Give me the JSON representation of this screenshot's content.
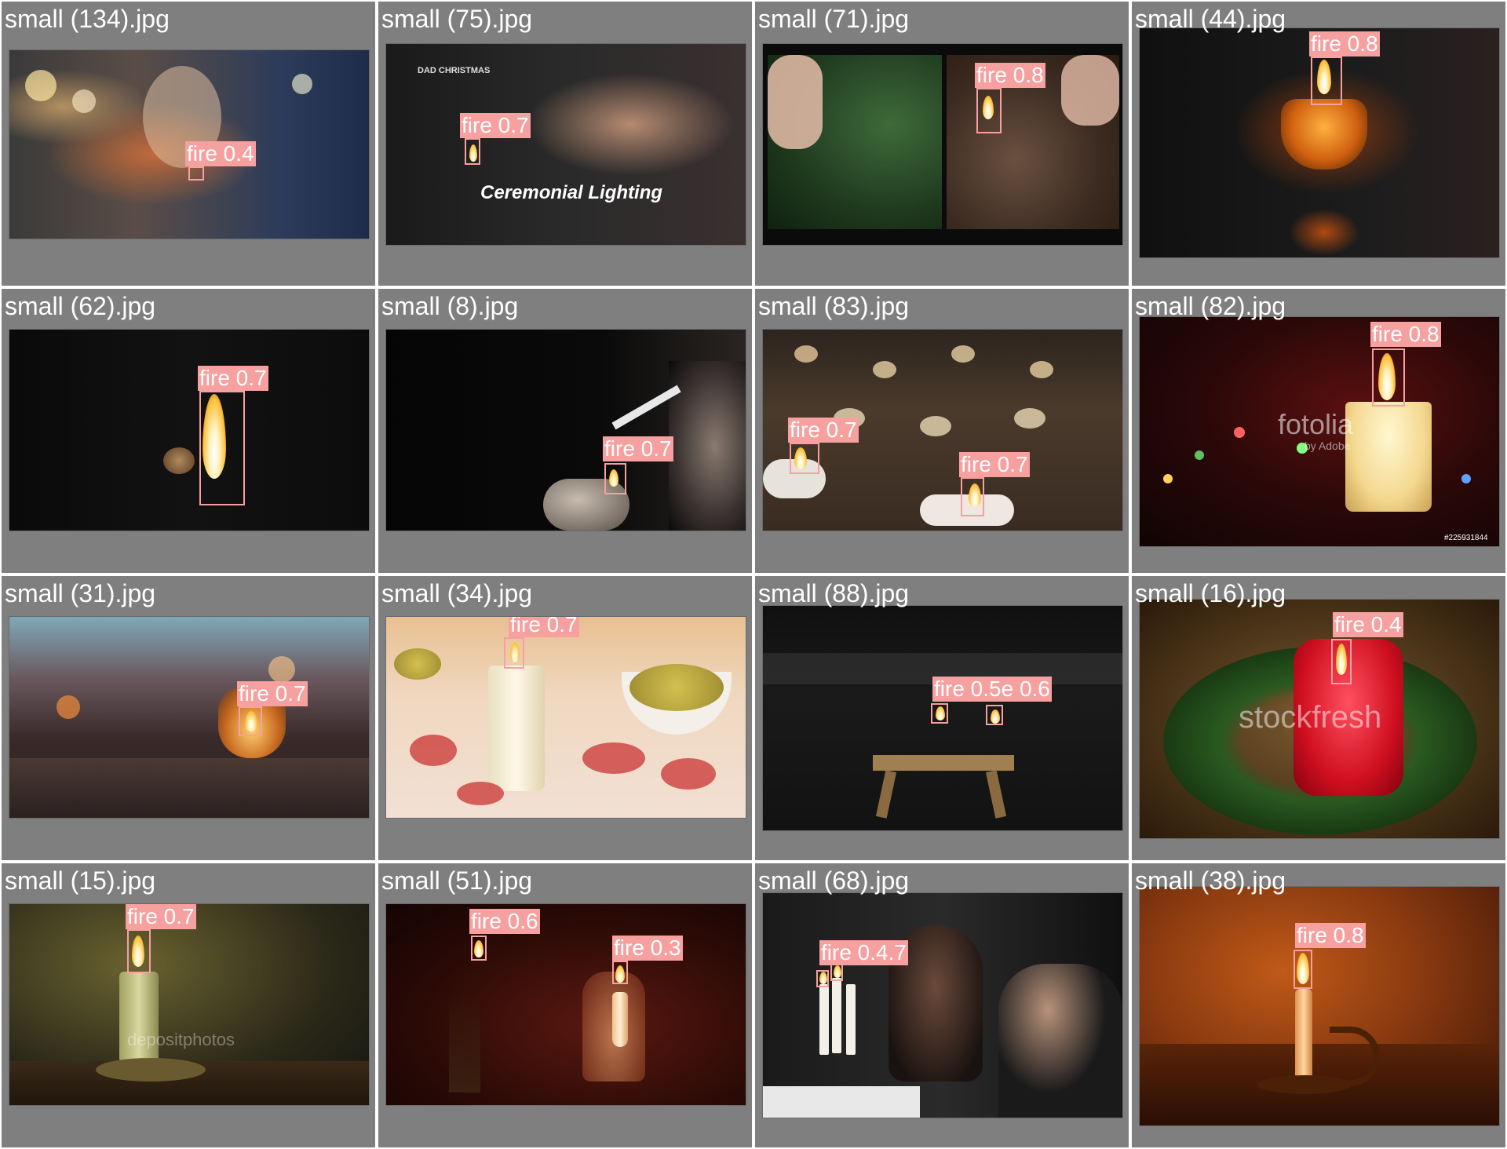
{
  "grid": {
    "cells": [
      {
        "filename": "small (134).jpg",
        "labels": [
          "fire 0.4"
        ],
        "scene": "man-lighting-cigarette"
      },
      {
        "filename": "small (75).jpg",
        "labels": [
          "fire 0.7"
        ],
        "scene": "ceremonial-lighting",
        "overlay": {
          "title": "Ceremonial Lighting",
          "logo": "DAD CHRISTMAS"
        }
      },
      {
        "filename": "small (71).jpg",
        "labels": [
          "fire 0.8"
        ],
        "scene": "two-smokers"
      },
      {
        "filename": "small (44).jpg",
        "labels": [
          "fire 0.8"
        ],
        "scene": "candle-glass-dark"
      },
      {
        "filename": "small (62).jpg",
        "labels": [
          "fire 0.7"
        ],
        "scene": "lighter-flame-dark"
      },
      {
        "filename": "small (8).jpg",
        "labels": [
          "fire 0.7"
        ],
        "scene": "cigarette-lighter-dark"
      },
      {
        "filename": "small (83).jpg",
        "labels": [
          "fire 0.7",
          "fire 0.7"
        ],
        "scene": "tealights-rows"
      },
      {
        "filename": "small (82).jpg",
        "labels": [
          "fire 0.8"
        ],
        "scene": "candle-bokeh-lights",
        "overlay": {
          "watermark": "fotolia",
          "sub": "by Adobe",
          "id": "#225931844"
        }
      },
      {
        "filename": "small (31).jpg",
        "labels": [
          "fire 0.7"
        ],
        "scene": "tealight-glass-bar"
      },
      {
        "filename": "small (34).jpg",
        "labels": [
          "fire 0.7"
        ],
        "scene": "candle-petals"
      },
      {
        "filename": "small (88).jpg",
        "labels": [
          "fire 0.5e 0.6"
        ],
        "scene": "lanterns-table-night"
      },
      {
        "filename": "small (16).jpg",
        "labels": [
          "fire 0.4"
        ],
        "scene": "red-candle-wreath",
        "overlay": {
          "watermark": "stockfresh"
        }
      },
      {
        "filename": "small (15).jpg",
        "labels": [
          "fire 0.7"
        ],
        "scene": "candlestick-holder",
        "overlay": {
          "watermark": "depositphotos"
        }
      },
      {
        "filename": "small (51).jpg",
        "labels": [
          "fire 0.6",
          "fire 0.3"
        ],
        "scene": "candles-dark-red"
      },
      {
        "filename": "small (68).jpg",
        "labels": [
          "fire 0.4.7"
        ],
        "scene": "dinner-candelabra"
      },
      {
        "filename": "small (38).jpg",
        "labels": [
          "fire 0.8"
        ],
        "scene": "single-candle-orange"
      }
    ]
  },
  "colors": {
    "cell_bg": "#7f7f7f",
    "box": "#f6a0a0",
    "grid_line": "#ffffff",
    "label_text": "#ffffff"
  }
}
